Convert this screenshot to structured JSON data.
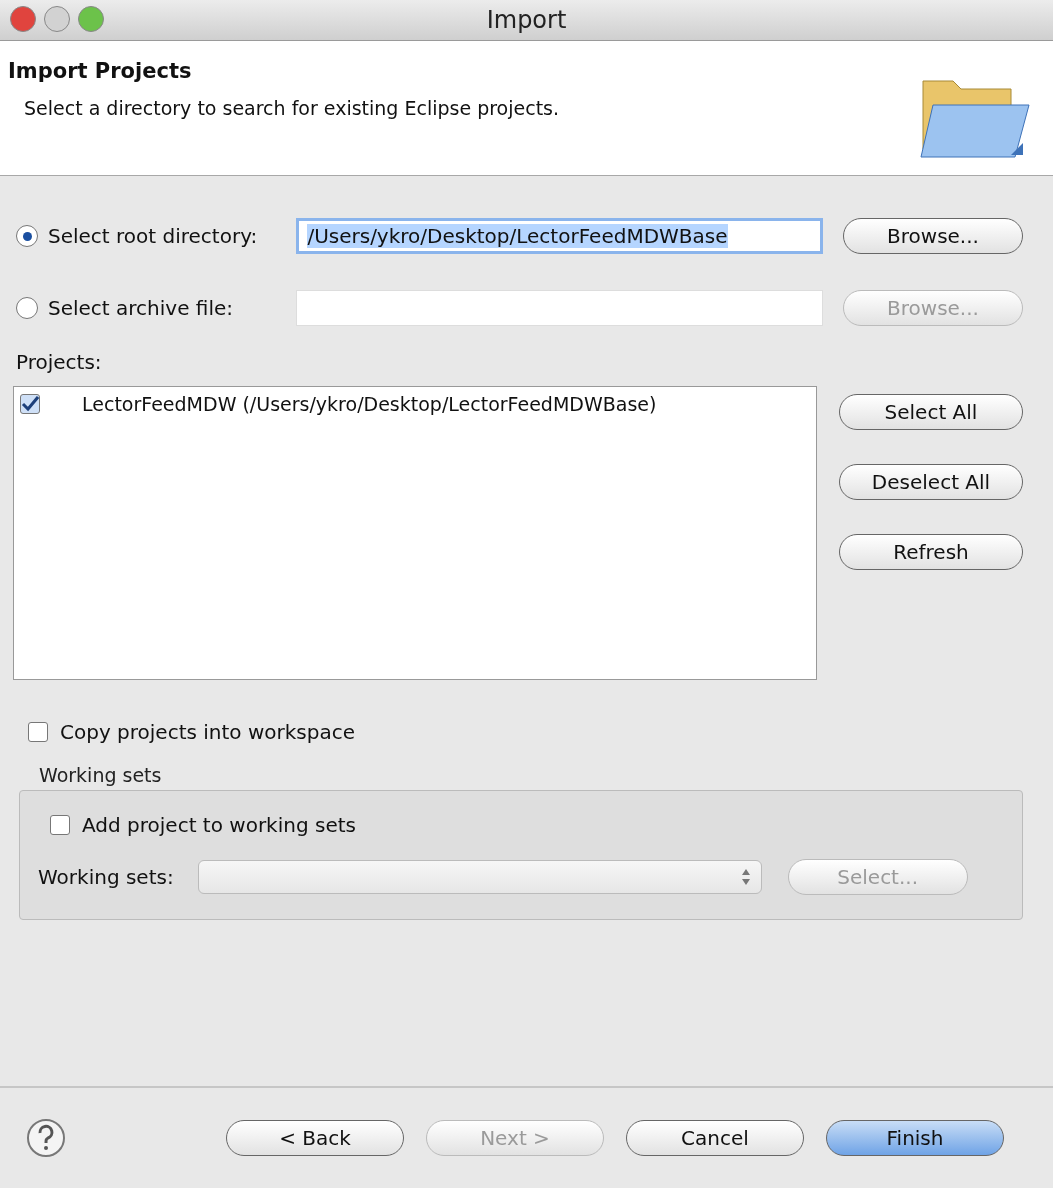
{
  "window": {
    "title": "Import"
  },
  "header": {
    "title": "Import Projects",
    "description": "Select a directory to search for existing Eclipse projects."
  },
  "source_options": [
    {
      "label": "Select root directory:",
      "selected": true,
      "value": "/Users/ykro/Desktop/LectorFeedMDWBase",
      "button": {
        "label": "Browse...",
        "disabled": false
      }
    },
    {
      "label": "Select archive file:",
      "selected": false,
      "button": {
        "label": "Browse...",
        "disabled": true
      }
    }
  ],
  "projects": {
    "label": "Projects:",
    "items": [
      {
        "label": "LectorFeedMDW (/Users/ykro/Desktop/LectorFeedMDWBase)",
        "checked": true
      }
    ],
    "buttons": [
      "Select All",
      "Deselect All",
      "Refresh"
    ]
  },
  "copy_into_workspace": {
    "label": "Copy projects into workspace",
    "checked": false
  },
  "working_sets": {
    "title": "Working sets",
    "add": {
      "label": "Add project to working sets",
      "checked": false
    },
    "field_label": "Working sets:",
    "select_button": {
      "label": "Select...",
      "disabled": true
    }
  },
  "footer_buttons": [
    {
      "label": "< Back",
      "disabled": false,
      "default": false
    },
    {
      "label": "Next >",
      "disabled": true,
      "default": false
    },
    {
      "label": "Cancel",
      "disabled": false,
      "default": false
    },
    {
      "label": "Finish",
      "disabled": false,
      "default": true
    }
  ]
}
